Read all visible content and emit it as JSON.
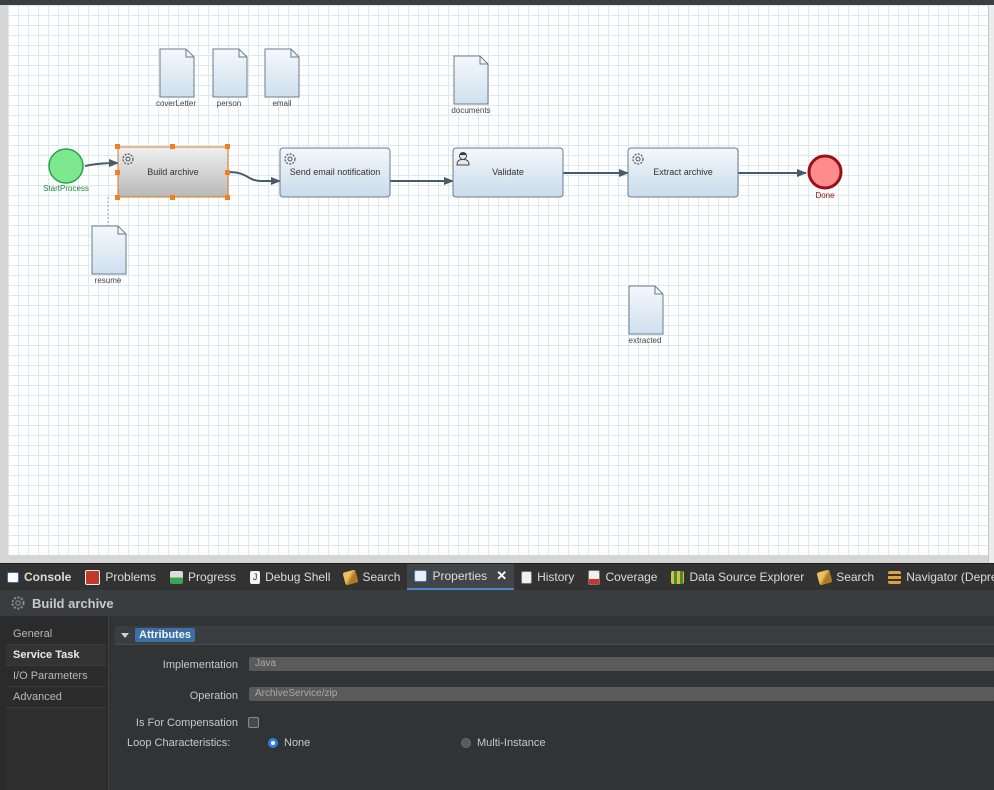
{
  "diagram": {
    "start_event": {
      "label": "StartProcess"
    },
    "end_event": {
      "label": "Done"
    },
    "tasks": [
      {
        "label": "Build archive",
        "type": "service",
        "icon": "gear-icon"
      },
      {
        "label": "Send email notification",
        "type": "service",
        "icon": "gear-icon"
      },
      {
        "label": "Validate",
        "type": "user",
        "icon": "user-icon"
      },
      {
        "label": "Extract archive",
        "type": "service",
        "icon": "gear-icon"
      }
    ],
    "data_objects": [
      {
        "label": "coverLetter"
      },
      {
        "label": "person"
      },
      {
        "label": "email"
      },
      {
        "label": "documents"
      },
      {
        "label": "resume"
      },
      {
        "label": "extracted"
      }
    ]
  },
  "tabs": [
    {
      "label": "Console",
      "icon": "console-icon",
      "active": false
    },
    {
      "label": "Problems",
      "icon": "problems-icon",
      "active": false
    },
    {
      "label": "Progress",
      "icon": "progress-icon",
      "active": false
    },
    {
      "label": "Debug Shell",
      "icon": "debug-shell-icon",
      "active": false
    },
    {
      "label": "Search",
      "icon": "search-icon",
      "active": false
    },
    {
      "label": "Properties",
      "icon": "properties-icon",
      "active": true
    },
    {
      "label": "History",
      "icon": "history-icon",
      "active": false
    },
    {
      "label": "Coverage",
      "icon": "coverage-icon",
      "active": false
    },
    {
      "label": "Data Source Explorer",
      "icon": "data-source-icon",
      "active": false
    },
    {
      "label": "Search",
      "icon": "search-icon",
      "active": false
    },
    {
      "label": "Navigator (Deprecated)",
      "icon": "navigator-icon",
      "active": false
    }
  ],
  "properties": {
    "title": "Build archive",
    "nav": [
      "General",
      "Service Task",
      "I/O Parameters",
      "Advanced"
    ],
    "selected_nav": "Service Task",
    "section": "Attributes",
    "implementation": {
      "label": "Implementation",
      "value": "Java"
    },
    "operation": {
      "label": "Operation",
      "value": "ArchiveService/zip"
    },
    "compensation": {
      "label": "Is For Compensation",
      "checked": false
    },
    "loop": {
      "label": "Loop Characteristics:",
      "options": [
        "None",
        "Multi-Instance"
      ],
      "selected": "None"
    }
  },
  "colors": {
    "accent": "#4a88c7",
    "start_fill": "#7ee88f",
    "end_fill": "#ff8c8c",
    "task_fill": "#dbe7f2",
    "selected_handle": "#f08020"
  }
}
